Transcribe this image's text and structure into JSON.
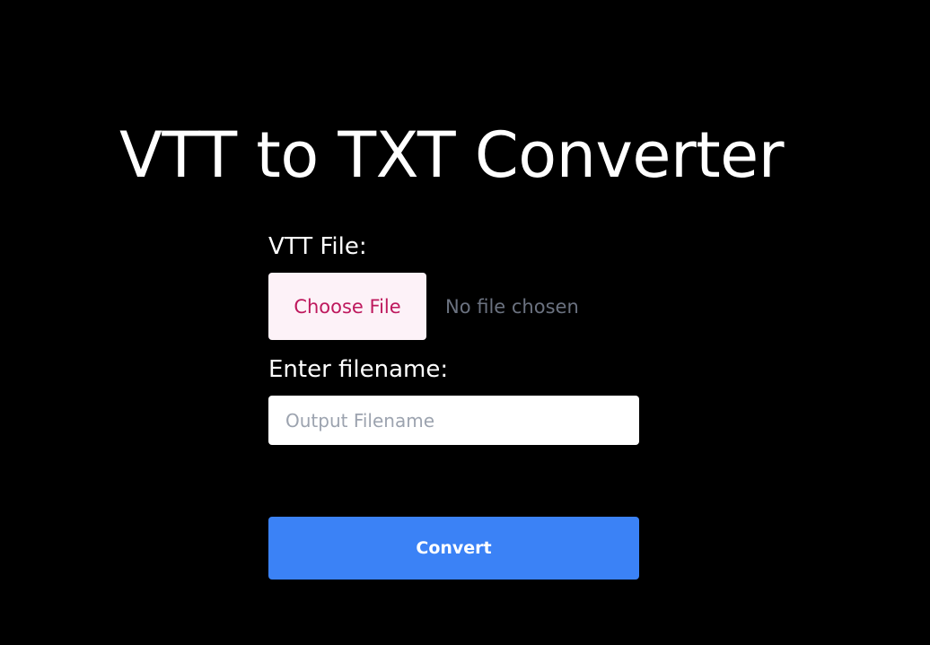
{
  "page": {
    "title": "VTT to TXT Converter"
  },
  "form": {
    "vtt_file_label": "VTT File:",
    "choose_file_button": "Choose File",
    "file_status": "No file chosen",
    "filename_label": "Enter filename:",
    "filename_input": {
      "value": "",
      "placeholder": "Output Filename"
    },
    "convert_button": "Convert"
  },
  "colors": {
    "background": "#000000",
    "choose_file_bg": "#fdf2f8",
    "choose_file_text": "#be185d",
    "convert_bg": "#3b82f6"
  }
}
